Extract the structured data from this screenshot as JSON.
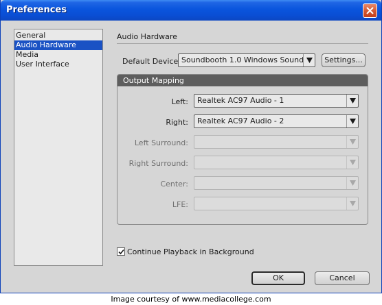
{
  "window": {
    "title": "Preferences"
  },
  "sidebar": {
    "items": [
      {
        "label": "General",
        "selected": false
      },
      {
        "label": "Audio Hardware",
        "selected": true
      },
      {
        "label": "Media",
        "selected": false
      },
      {
        "label": "User Interface",
        "selected": false
      }
    ]
  },
  "audio": {
    "section_title": "Audio Hardware",
    "default_device_label": "Default Device:",
    "default_device_value": "Soundbooth 1.0 Windows Sound",
    "settings_button": "Settings..."
  },
  "mapping": {
    "header": "Output Mapping",
    "rows": [
      {
        "label": "Left:",
        "value": "Realtek AC97 Audio - 1",
        "enabled": true
      },
      {
        "label": "Right:",
        "value": "Realtek AC97 Audio - 2",
        "enabled": true
      },
      {
        "label": "Left Surround:",
        "value": "",
        "enabled": false
      },
      {
        "label": "Right Surround:",
        "value": "",
        "enabled": false
      },
      {
        "label": "Center:",
        "value": "",
        "enabled": false
      },
      {
        "label": "LFE:",
        "value": "",
        "enabled": false
      }
    ]
  },
  "playback": {
    "checkbox_label": "Continue Playback in Background",
    "checked": true
  },
  "buttons": {
    "ok": "OK",
    "cancel": "Cancel"
  },
  "credit": "Image courtesy of www.mediacollege.com",
  "icons": {
    "close": "close-icon",
    "dropdown": "chevron-down-icon",
    "check": "check-icon"
  },
  "colors": {
    "titlebar": "#0a55dd",
    "selection": "#1a52c4",
    "group_header": "#5e5e5e",
    "dialog": "#d6d6d6"
  }
}
